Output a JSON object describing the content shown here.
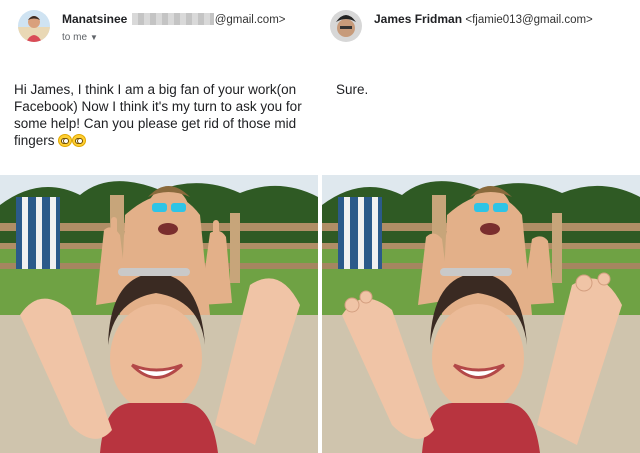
{
  "left_email": {
    "sender_name": "Manatsinee",
    "sender_email_suffix": "@gmail.com>",
    "recipient_label": "to me",
    "body": "Hi James, I think I am a big fan of your work(on Facebook) Now I think it's my turn to ask you for some help! Can you please get rid of those mid fingers",
    "emoji_icons": [
      "flushed-face-emoji",
      "smiling-face-emoji"
    ]
  },
  "right_email": {
    "sender_name": "James Fridman",
    "sender_email": "<fjamie013@gmail.com>",
    "body": "Sure."
  },
  "photos": {
    "original": "photo-with-middle-fingers",
    "edited": "photo-with-toes-instead"
  },
  "colors": {
    "text": "#202124",
    "muted": "#5f6368",
    "sky": "#dfe8ee",
    "grass": "#6fa244",
    "trees": "#2f5a24",
    "skin": "#e8b48e",
    "sunglasses_lens": "#2ec4e6"
  }
}
